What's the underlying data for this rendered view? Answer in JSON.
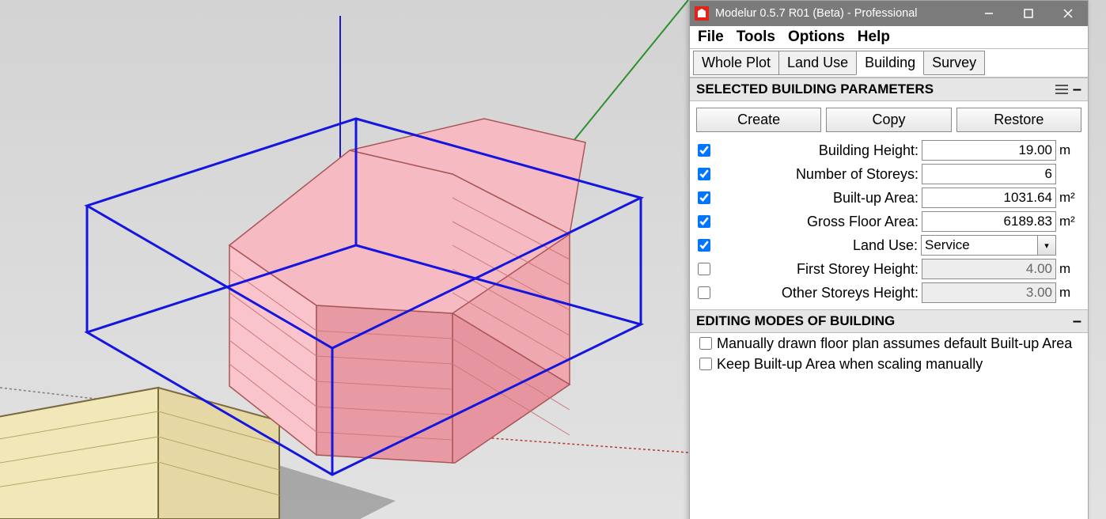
{
  "window": {
    "title": "Modelur 0.5.7 R01 (Beta) - Professional"
  },
  "menubar": {
    "items": [
      "File",
      "Tools",
      "Options",
      "Help"
    ]
  },
  "tabs": {
    "items": [
      "Whole Plot",
      "Land Use",
      "Building",
      "Survey"
    ],
    "active_index": 2
  },
  "section_parameters": {
    "title": "SELECTED BUILDING PARAMETERS",
    "buttons": {
      "create": "Create",
      "copy": "Copy",
      "restore": "Restore"
    },
    "params": [
      {
        "checked": true,
        "label": "Building Height:",
        "value": "19.00",
        "unit": "m",
        "enabled": true,
        "type": "text"
      },
      {
        "checked": true,
        "label": "Number of Storeys:",
        "value": "6",
        "unit": "",
        "enabled": true,
        "type": "text"
      },
      {
        "checked": true,
        "label": "Built-up Area:",
        "value": "1031.64",
        "unit": "m²",
        "enabled": true,
        "type": "text"
      },
      {
        "checked": true,
        "label": "Gross Floor Area:",
        "value": "6189.83",
        "unit": "m²",
        "enabled": true,
        "type": "text"
      },
      {
        "checked": true,
        "label": "Land Use:",
        "value": "Service",
        "unit": "",
        "enabled": true,
        "type": "combo"
      },
      {
        "checked": false,
        "label": "First Storey Height:",
        "value": "4.00",
        "unit": "m",
        "enabled": false,
        "type": "text"
      },
      {
        "checked": false,
        "label": "Other Storeys Height:",
        "value": "3.00",
        "unit": "m",
        "enabled": false,
        "type": "text"
      }
    ]
  },
  "section_editing": {
    "title": "EDITING MODES OF BUILDING",
    "items": [
      {
        "checked": false,
        "label": "Manually drawn floor plan assumes default Built-up Area"
      },
      {
        "checked": false,
        "label": "Keep Built-up Area when scaling manually"
      }
    ]
  }
}
